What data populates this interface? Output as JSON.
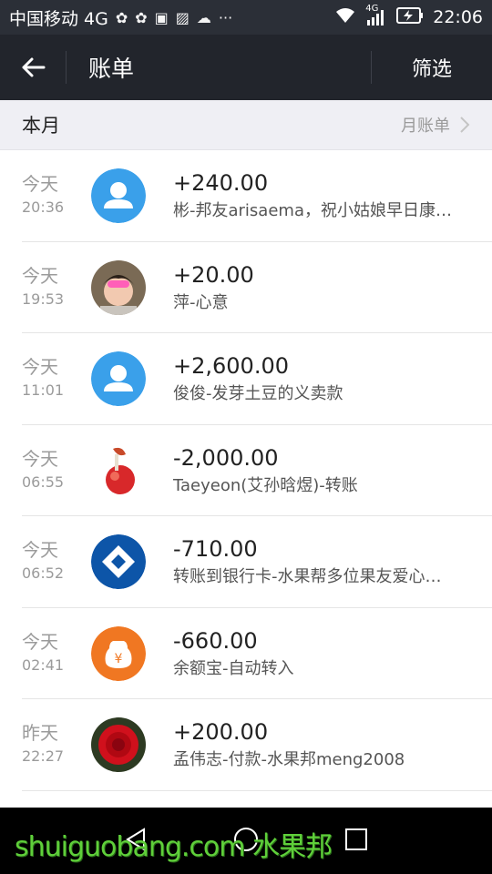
{
  "status_bar": {
    "carrier": "中国移动 4G",
    "icons": [
      "wechat-icon",
      "wechat-icon",
      "sim-card-icon",
      "image-icon",
      "cloud-icon",
      "more-icon"
    ],
    "network": "4G",
    "time": "22:06"
  },
  "nav": {
    "title": "账单",
    "filter_label": "筛选"
  },
  "section": {
    "label": "本月",
    "monthly_bill_label": "月账单"
  },
  "transactions": [
    {
      "day": "今天",
      "time": "20:36",
      "amount": "+240.00",
      "desc": "彬-邦友arisaema，祝小姑娘早日康…",
      "avatar": "default-user-avatar"
    },
    {
      "day": "今天",
      "time": "19:53",
      "amount": "+20.00",
      "desc": "萍-心意",
      "avatar": "child-photo-avatar"
    },
    {
      "day": "今天",
      "time": "11:01",
      "amount": "+2,600.00",
      "desc": "俊俊-发芽土豆的义卖款",
      "avatar": "default-user-avatar"
    },
    {
      "day": "今天",
      "time": "06:55",
      "amount": "-2,000.00",
      "desc": "Taeyeon(艾孙晗煜)-转账",
      "avatar": "apple-photo-avatar"
    },
    {
      "day": "今天",
      "time": "06:52",
      "amount": "-710.00",
      "desc": "转账到银行卡-水果帮多位果友爱心…",
      "avatar": "bank-logo-avatar"
    },
    {
      "day": "今天",
      "time": "02:41",
      "amount": "-660.00",
      "desc": "余额宝-自动转入",
      "avatar": "yuebao-icon-avatar"
    },
    {
      "day": "昨天",
      "time": "22:27",
      "amount": "+200.00",
      "desc": "孟伟志-付款-水果邦meng2008",
      "avatar": "rose-photo-avatar"
    }
  ],
  "watermark": "shuiguobang.com 水果邦",
  "colors": {
    "navbar": "#22252c",
    "default_avatar": "#3aa0ea",
    "bank_blue": "#0d55a8",
    "yuebao_orange": "#f07722"
  }
}
